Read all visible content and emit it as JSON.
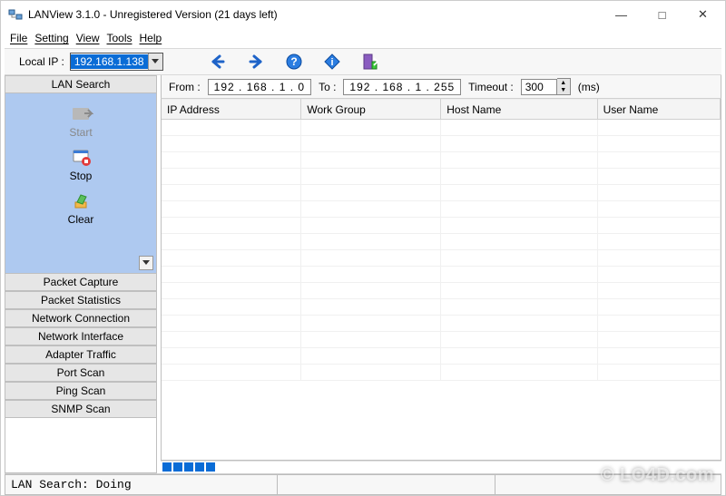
{
  "window": {
    "title": "LANView 3.1.0 - Unregistered Version (21 days left)"
  },
  "menu": {
    "items": [
      "File",
      "Setting",
      "View",
      "Tools",
      "Help"
    ]
  },
  "toolbar": {
    "local_ip_label": "Local IP :",
    "local_ip_value": "192.168.1.138"
  },
  "sidebar": {
    "header": "LAN Search",
    "actions": {
      "start_label": "Start",
      "stop_label": "Stop",
      "clear_label": "Clear"
    },
    "sections": [
      "Packet Capture",
      "Packet Statistics",
      "Network Connection",
      "Network Interface",
      "Adapter Traffic",
      "Port Scan",
      "Ping Scan",
      "SNMP Scan"
    ]
  },
  "ipbar": {
    "from_label": "From :",
    "from_value": "192 . 168 .   1  .   0",
    "to_label": "To :",
    "to_value": "192 . 168 .   1  . 255",
    "timeout_label": "Timeout :",
    "timeout_value": "300",
    "timeout_unit": "(ms)"
  },
  "table": {
    "columns": [
      "IP Address",
      "Work Group",
      "Host Name",
      "User Name"
    ]
  },
  "status": {
    "text": "LAN Search: Doing"
  },
  "watermark": "© LO4D.com"
}
